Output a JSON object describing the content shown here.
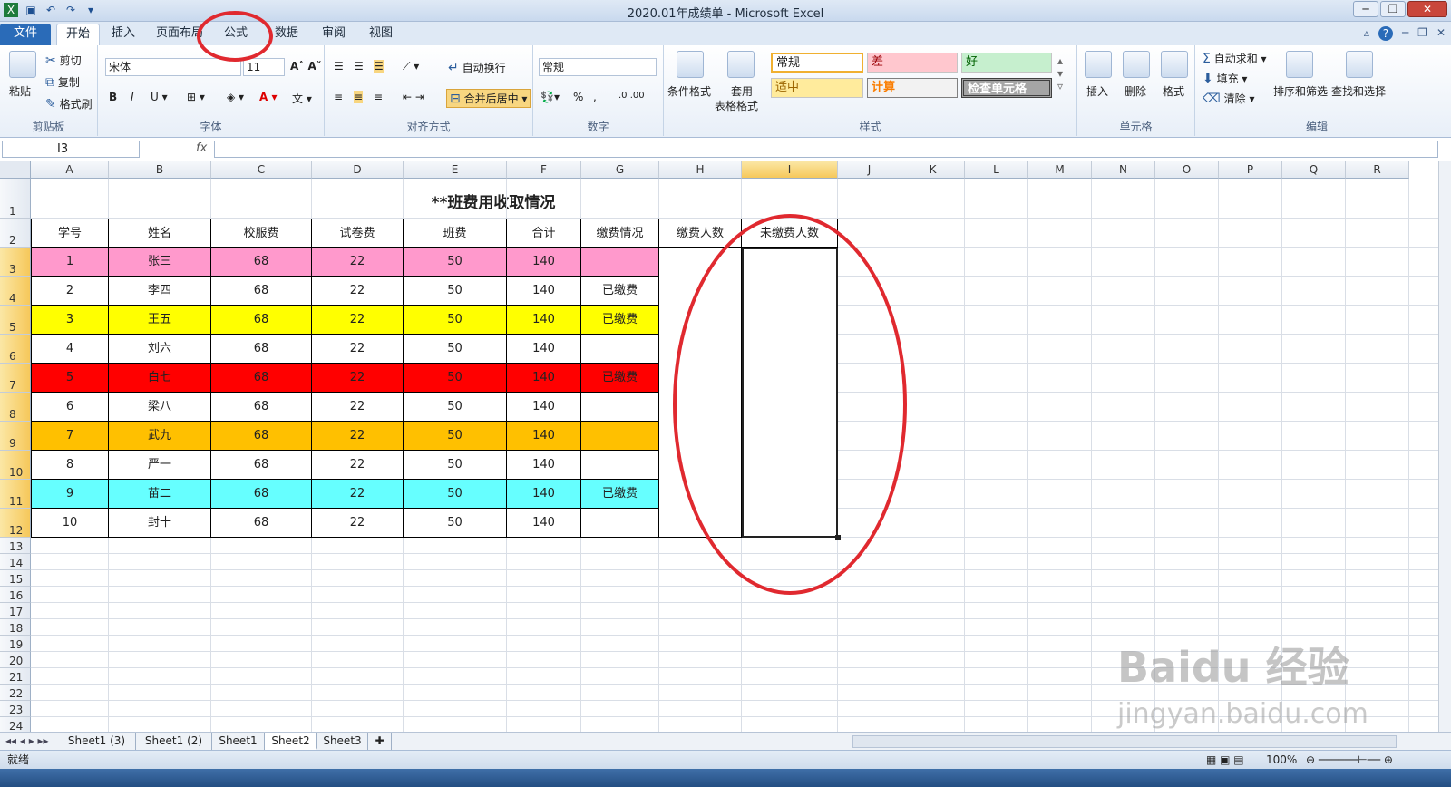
{
  "window": {
    "title": "2020.01年成绩单 - Microsoft Excel"
  },
  "tabs": {
    "file": "文件",
    "home": "开始",
    "insert": "插入",
    "page_layout": "页面布局",
    "formulas": "公式",
    "data": "数据",
    "review": "审阅",
    "view": "视图"
  },
  "ribbon": {
    "clipboard": {
      "label": "剪贴板",
      "paste": "粘贴",
      "cut": "剪切",
      "copy": "复制",
      "format_painter": "格式刷"
    },
    "font": {
      "label": "字体",
      "name": "宋体",
      "size": "11"
    },
    "alignment": {
      "label": "对齐方式",
      "wrap": "自动换行",
      "merge": "合并后居中"
    },
    "number": {
      "label": "数字",
      "format": "常规"
    },
    "styles": {
      "label": "样式",
      "conditional": "条件格式",
      "table_format_1": "套用",
      "table_format_2": "表格格式",
      "normal": "常规",
      "bad": "差",
      "good": "好",
      "neutral": "适中",
      "calculation": "计算",
      "check_cell": "检查单元格"
    },
    "cells": {
      "label": "单元格",
      "insert": "插入",
      "delete": "删除",
      "format": "格式"
    },
    "editing": {
      "label": "编辑",
      "autosum": "自动求和",
      "fill": "填充",
      "clear": "清除",
      "sort_filter": "排序和筛选",
      "find_select": "查找和选择"
    }
  },
  "formula_bar": {
    "name_box": "I3",
    "fx": "fx",
    "formula": ""
  },
  "columns": [
    "A",
    "B",
    "C",
    "D",
    "E",
    "F",
    "G",
    "H",
    "I",
    "J",
    "K",
    "L",
    "M",
    "N",
    "O",
    "P",
    "Q",
    "R"
  ],
  "rows": [
    "1",
    "2",
    "3",
    "4",
    "5",
    "6",
    "7",
    "8",
    "9",
    "10",
    "11",
    "12",
    "13",
    "14",
    "15",
    "16",
    "17",
    "18",
    "19",
    "20",
    "21",
    "22",
    "23",
    "24"
  ],
  "sheet": {
    "title": "**班费用收取情况",
    "headers": [
      "学号",
      "姓名",
      "校服费",
      "试卷费",
      "班费",
      "合计",
      "缴费情况",
      "缴费人数",
      "未缴费人数"
    ],
    "data_rows": [
      {
        "cells": [
          "1",
          "张三",
          "68",
          "22",
          "50",
          "140",
          ""
        ],
        "fill": "#ff99cc"
      },
      {
        "cells": [
          "2",
          "李四",
          "68",
          "22",
          "50",
          "140",
          "已缴费"
        ],
        "fill": "#ffffff"
      },
      {
        "cells": [
          "3",
          "王五",
          "68",
          "22",
          "50",
          "140",
          "已缴费"
        ],
        "fill": "#ffff00"
      },
      {
        "cells": [
          "4",
          "刘六",
          "68",
          "22",
          "50",
          "140",
          ""
        ],
        "fill": "#ffffff"
      },
      {
        "cells": [
          "5",
          "白七",
          "68",
          "22",
          "50",
          "140",
          "已缴费"
        ],
        "fill": "#ff0000"
      },
      {
        "cells": [
          "6",
          "梁八",
          "68",
          "22",
          "50",
          "140",
          ""
        ],
        "fill": "#ffffff"
      },
      {
        "cells": [
          "7",
          "武九",
          "68",
          "22",
          "50",
          "140",
          ""
        ],
        "fill": "#ffc000"
      },
      {
        "cells": [
          "8",
          "严一",
          "68",
          "22",
          "50",
          "140",
          ""
        ],
        "fill": "#ffffff"
      },
      {
        "cells": [
          "9",
          "苗二",
          "68",
          "22",
          "50",
          "140",
          "已缴费"
        ],
        "fill": "#66ffff"
      },
      {
        "cells": [
          "10",
          "封十",
          "68",
          "22",
          "50",
          "140",
          ""
        ],
        "fill": "#ffffff"
      }
    ]
  },
  "sheet_tabs": [
    "Sheet1 (3)",
    "Sheet1 (2)",
    "Sheet1",
    "Sheet2",
    "Sheet3"
  ],
  "active_sheet": "Sheet2",
  "status": {
    "ready": "就绪",
    "zoom": "100%"
  },
  "watermark": {
    "brand": "Bai",
    "brand_cn": "经验",
    "url": "jingyan.baidu.com"
  },
  "accent": {
    "annotation": "#e0292f",
    "selection": "#f6c85b",
    "file_tab": "#2a6bb8"
  }
}
